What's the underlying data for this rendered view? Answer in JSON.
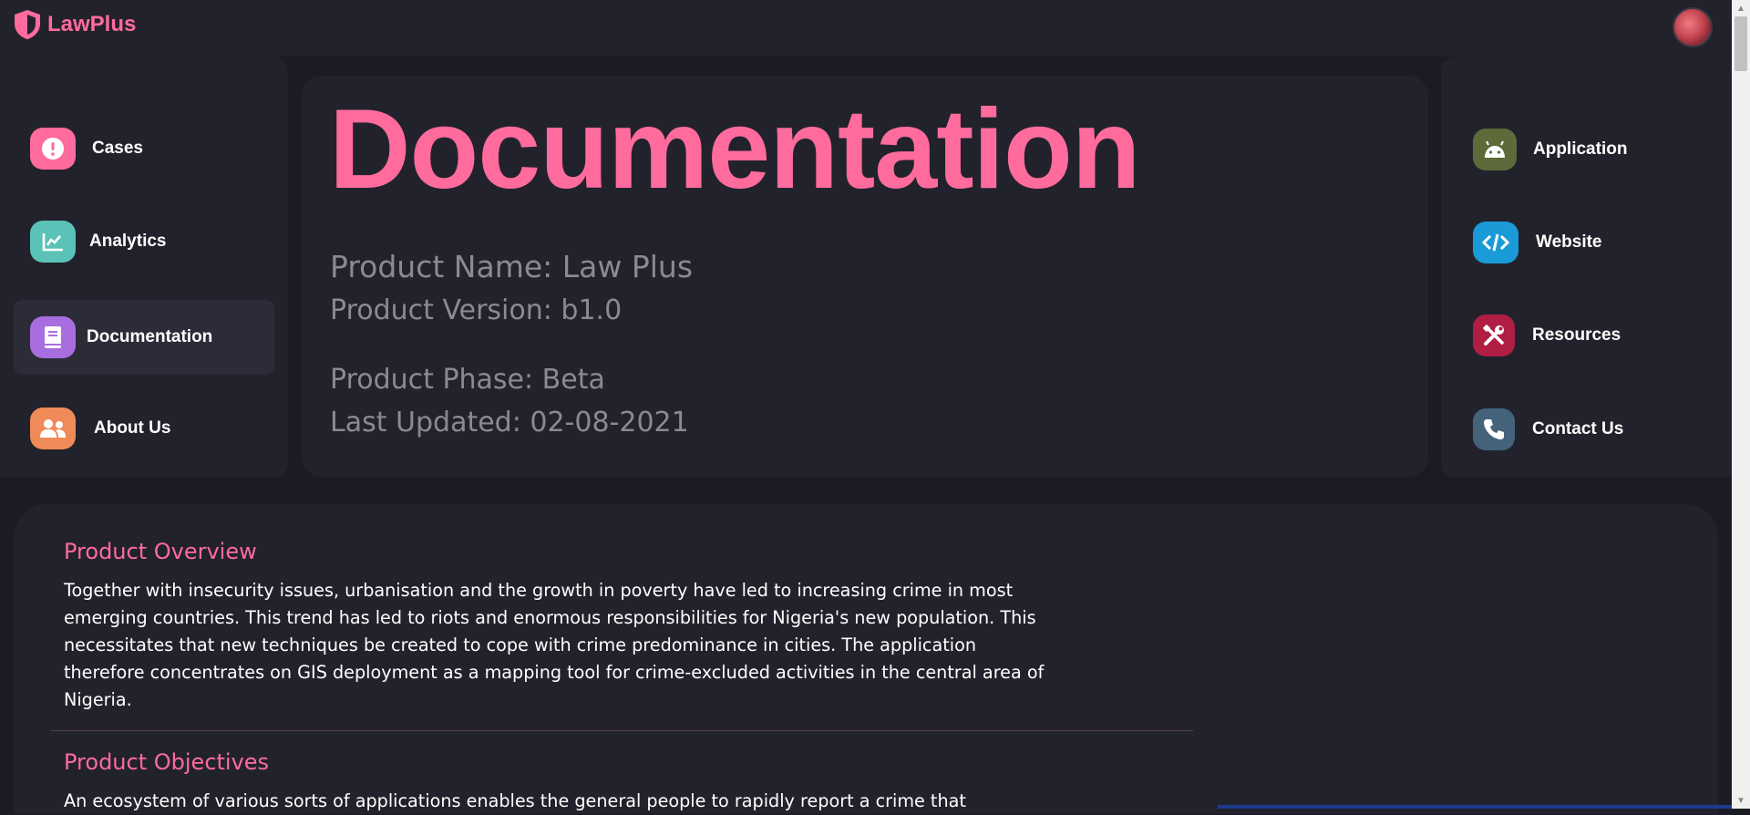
{
  "brand": {
    "name": "LawPlus",
    "logo_icon": "shield-icon",
    "color": "#ff6b9d"
  },
  "avatar": {
    "icon": "user-avatar"
  },
  "left_nav": [
    {
      "label": "Cases",
      "icon": "exclamation-icon",
      "color": "#ff6b9d",
      "active": false
    },
    {
      "label": "Analytics",
      "icon": "chart-line-icon",
      "color": "#5bc2b8",
      "active": false
    },
    {
      "label": "Documentation",
      "icon": "book-icon",
      "color": "#a86ee0",
      "active": true
    },
    {
      "label": "About Us",
      "icon": "users-icon",
      "color": "#f08a58",
      "active": false
    }
  ],
  "right_nav": [
    {
      "label": "Application",
      "icon": "android-icon",
      "color": "#5d6a3a"
    },
    {
      "label": "Website",
      "icon": "code-icon",
      "color": "#1a9ad6"
    },
    {
      "label": "Resources",
      "icon": "tools-icon",
      "color": "#b01e44"
    },
    {
      "label": "Contact Us",
      "icon": "phone-icon",
      "color": "#44627a"
    }
  ],
  "hero": {
    "title": "Documentation",
    "product_name": "Product Name: Law Plus",
    "product_version": "Product Version: b1.0",
    "product_phase": "Product Phase: Beta",
    "last_updated": "Last Updated: 02-08-2021"
  },
  "sections": {
    "overview_title": "Product Overview",
    "overview_body": "Together with insecurity issues, urbanisation and the growth in poverty have led to increasing crime in most emerging countries. This trend has led to riots and enormous responsibilities for Nigeria's new population. This necessitates that new techniques be created to cope with crime predominance in cities. The application therefore concentrates on GIS deployment as a mapping tool for crime-excluded activities in the central area of Nigeria.",
    "objectives_title": "Product Objectives",
    "objectives_body": "An ecosystem of various sorts of applications enables the general people to rapidly report a crime that"
  }
}
